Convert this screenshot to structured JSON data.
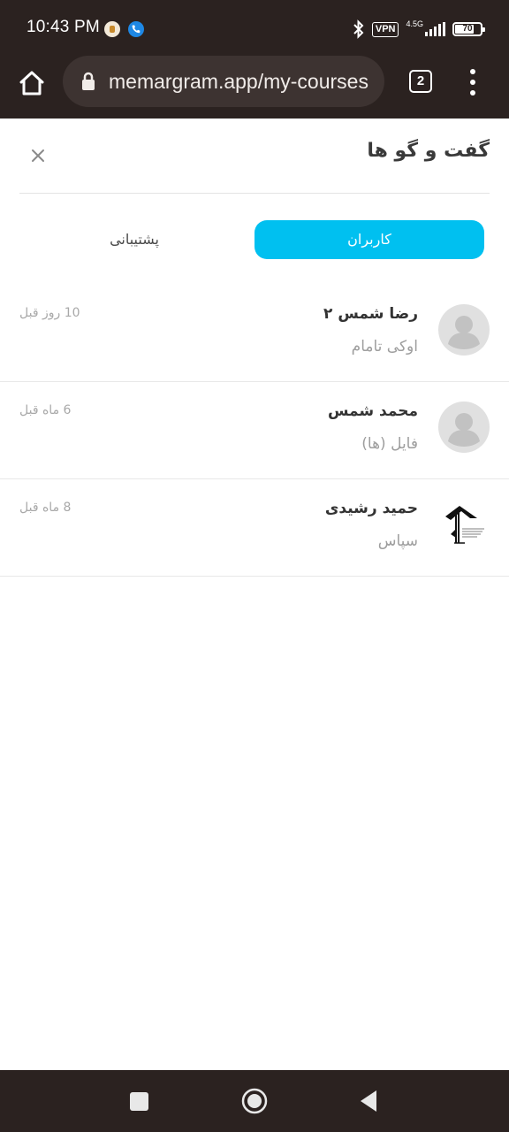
{
  "status_bar": {
    "time": "10:43 PM",
    "vpn": "VPN",
    "network": "4.5G",
    "battery": "70",
    "battery_level": 0.7
  },
  "browser": {
    "url": "memargram.app/my-courses",
    "tab_count": "2"
  },
  "chat": {
    "title": "گفت و گو ها",
    "tabs": [
      {
        "label": "کاربران",
        "active": true
      },
      {
        "label": "پشتیبانی",
        "active": false
      }
    ],
    "conversations": [
      {
        "name": "رضا شمس ۲",
        "message": "اوکی تامام",
        "time": "10 روز قبل",
        "avatar": "default-avatar"
      },
      {
        "name": "محمد شمس",
        "message": "فایل (ها)",
        "time": "6 ماه قبل",
        "avatar": "default-avatar"
      },
      {
        "name": "حمید رشیدی",
        "message": "سپاس",
        "time": "8 ماه قبل",
        "avatar": "logo-avatar"
      }
    ]
  },
  "colors": {
    "accent": "#00c0f0",
    "system_bar": "#2b2220"
  }
}
